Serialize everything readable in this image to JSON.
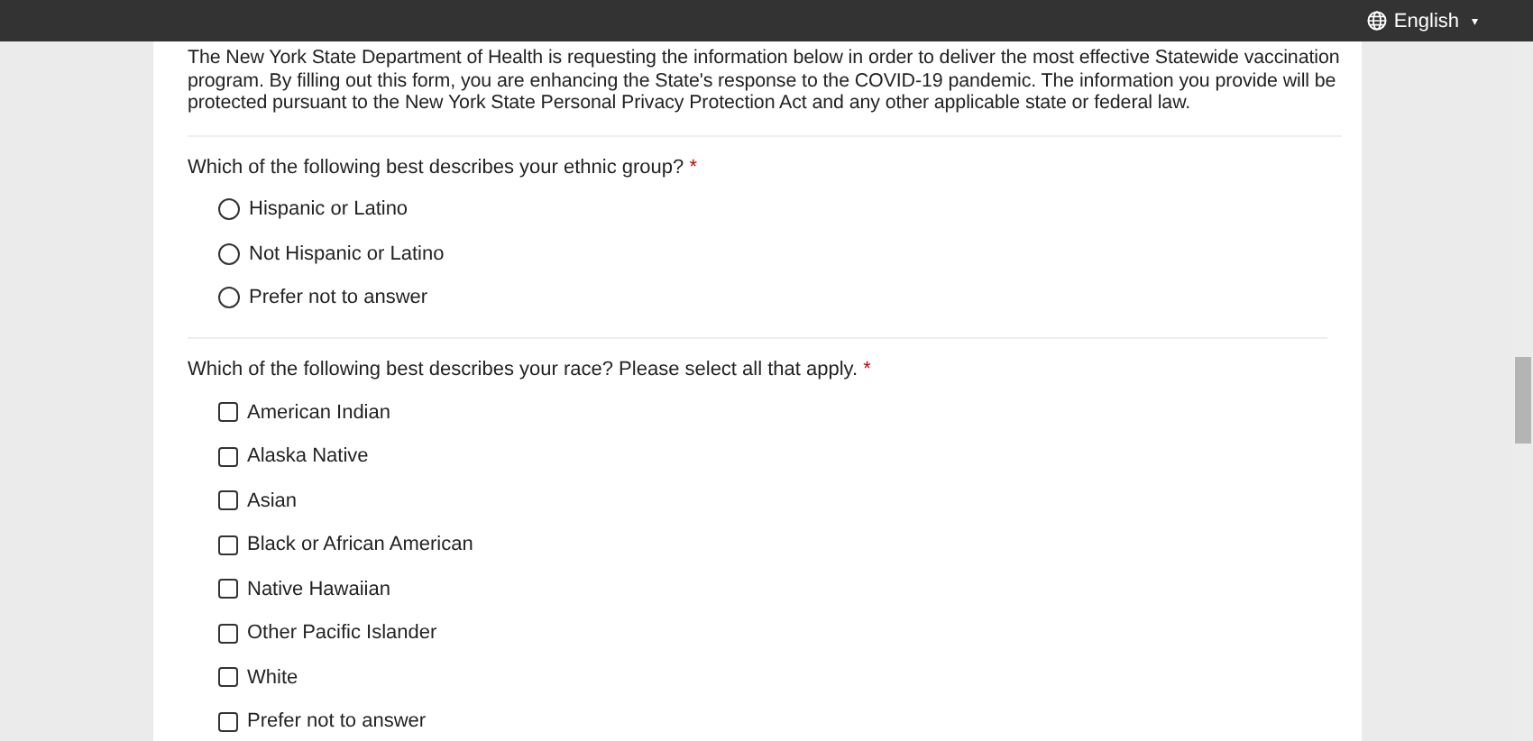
{
  "language_menu": {
    "label": "English",
    "caret": "▾"
  },
  "intro": "The New York State Department of Health is requesting the information below in order to deliver the most effective Statewide vaccination program. By filling out this form, you are enhancing the State's response to the COVID-19 pandemic. The information you provide will be protected pursuant to the New York State Personal Privacy Protection Act and any other applicable state or federal law.",
  "questions": [
    {
      "kind": "radio",
      "label": "Which of the following best describes your ethnic group?",
      "required_mark": "*",
      "options": [
        {
          "label": "Hispanic or Latino",
          "selected": false
        },
        {
          "label": "Not Hispanic or Latino",
          "selected": false
        },
        {
          "label": "Prefer not to answer",
          "selected": false
        }
      ]
    },
    {
      "kind": "checkbox",
      "label": "Which of the following best describes your race? Please select all that apply.",
      "required_mark": "*",
      "options": [
        {
          "label": "American Indian",
          "checked": false
        },
        {
          "label": "Alaska Native",
          "checked": false
        },
        {
          "label": "Asian",
          "checked": false
        },
        {
          "label": "Black or African American",
          "checked": false
        },
        {
          "label": "Native Hawaiian",
          "checked": false
        },
        {
          "label": "Other Pacific Islander",
          "checked": false
        },
        {
          "label": "White",
          "checked": false
        },
        {
          "label": "Prefer not to answer",
          "checked": false
        }
      ]
    }
  ]
}
